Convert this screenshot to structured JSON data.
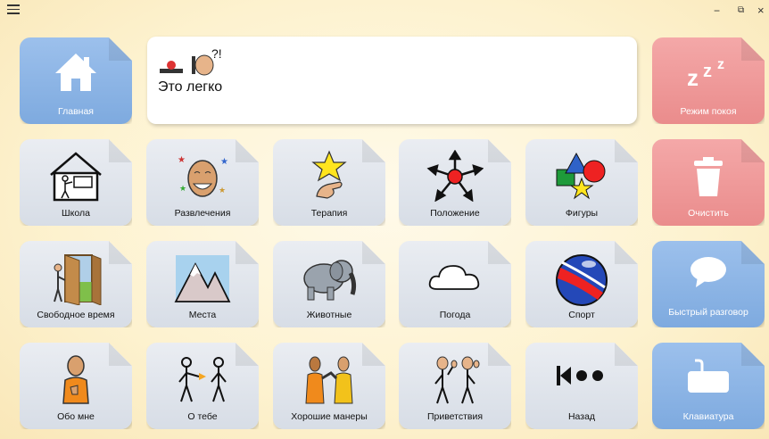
{
  "window": {
    "menu_icon": "hamburger-icon",
    "minimize": "−",
    "restore": "⧉",
    "close": "×"
  },
  "message": {
    "text": "Это легко",
    "symbols": [
      "light-icon",
      "person-question-icon"
    ]
  },
  "tiles": {
    "home": {
      "label": "Главная",
      "icon": "home-icon",
      "color": "#8db6e8"
    },
    "sleep": {
      "label": "Режим покоя",
      "icon": "zzz-icon",
      "color": "#ef9a9a"
    },
    "school": {
      "label": "Школа",
      "icon": "school-icon"
    },
    "fun": {
      "label": "Развлечения",
      "icon": "laughing-face-icon"
    },
    "therapy": {
      "label": "Терапия",
      "icon": "star-hand-icon"
    },
    "position": {
      "label": "Положение",
      "icon": "arrows-icon"
    },
    "shapes": {
      "label": "Фигуры",
      "icon": "shapes-icon"
    },
    "clear": {
      "label": "Очистить",
      "icon": "trash-icon",
      "color": "#ef9a9a"
    },
    "free_time": {
      "label": "Свободное время",
      "icon": "door-icon"
    },
    "places": {
      "label": "Места",
      "icon": "mountain-icon"
    },
    "animals": {
      "label": "Животные",
      "icon": "elephant-icon"
    },
    "weather": {
      "label": "Погода",
      "icon": "cloud-icon"
    },
    "sport": {
      "label": "Спорт",
      "icon": "ball-icon"
    },
    "quick_talk": {
      "label": "Быстрый разговор",
      "icon": "speech-bubble-icon",
      "color": "#8db6e8"
    },
    "about_me": {
      "label": "Обо мне",
      "icon": "person-self-icon"
    },
    "about_you": {
      "label": "О тебе",
      "icon": "person-other-icon"
    },
    "manners": {
      "label": "Хорошие манеры",
      "icon": "people-manners-icon"
    },
    "greetings": {
      "label": "Приветствия",
      "icon": "people-greeting-icon"
    },
    "back": {
      "label": "Назад",
      "icon": "back-icon"
    },
    "keyboard": {
      "label": "Клавиатура",
      "icon": "keyboard-icon",
      "color": "#8db6e8"
    }
  }
}
